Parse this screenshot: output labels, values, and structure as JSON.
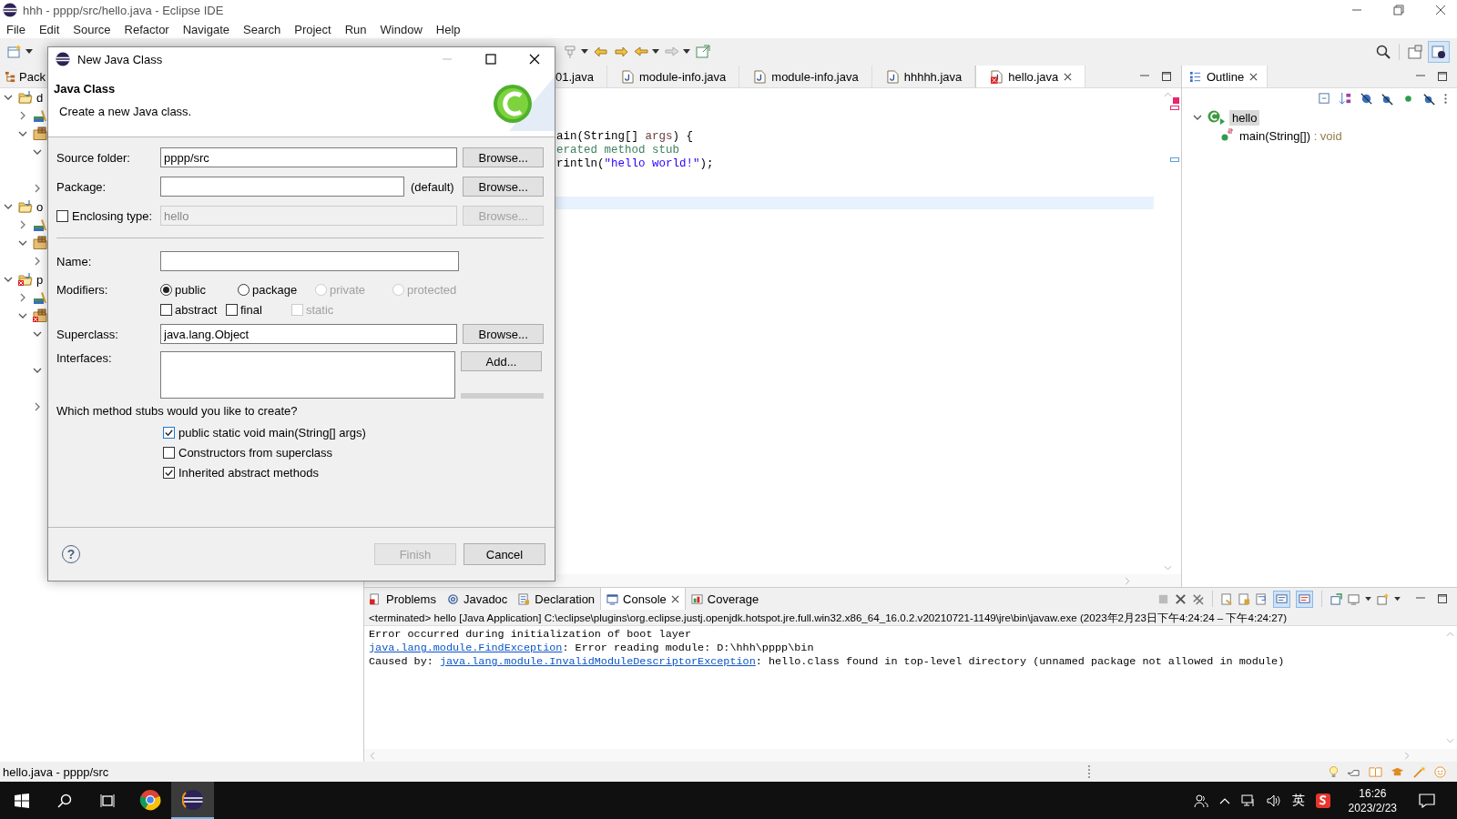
{
  "window": {
    "title": "hhh - pppp/src/hello.java - Eclipse IDE"
  },
  "menu": [
    "File",
    "Edit",
    "Source",
    "Refactor",
    "Navigate",
    "Search",
    "Project",
    "Run",
    "Window",
    "Help"
  ],
  "package_explorer": {
    "tab": "Pack",
    "tree": [
      {
        "label": "d",
        "kind": "project",
        "error": false,
        "expanded": true,
        "children": [
          {
            "kind": "library",
            "error": false,
            "expanded": false
          },
          {
            "kind": "package",
            "error": false,
            "expanded": true,
            "children": [
              {
                "expanded": true
              },
              {
                "expanded": false
              }
            ]
          }
        ]
      },
      {
        "label": "o",
        "kind": "project",
        "error": false,
        "expanded": true,
        "children": [
          {
            "kind": "library",
            "error": false,
            "expanded": false
          },
          {
            "kind": "package",
            "error": false,
            "expanded": true,
            "children": [
              {
                "expanded": false
              }
            ]
          }
        ]
      },
      {
        "label": "p",
        "kind": "project",
        "error": true,
        "expanded": true,
        "children": [
          {
            "kind": "library",
            "error": false,
            "expanded": false
          },
          {
            "kind": "package",
            "error": true,
            "expanded": true,
            "children": [
              {
                "expanded": true
              },
              {
                "expanded": true
              },
              {
                "expanded": false
              }
            ]
          }
        ]
      }
    ]
  },
  "editor": {
    "tabs": [
      {
        "label": "01.java",
        "selected": false
      },
      {
        "label": "module-info.java",
        "selected": false,
        "error": false
      },
      {
        "label": "module-info.java",
        "selected": false,
        "error": false
      },
      {
        "label": "hhhhh.java",
        "selected": false,
        "error": false
      },
      {
        "label": "hello.java",
        "selected": true,
        "error": true
      }
    ],
    "lines": [
      [
        {
          "kind": "code",
          "text": "ain(String[] "
        },
        {
          "kind": "param",
          "text": "args"
        },
        {
          "kind": "code",
          "text": ") {"
        }
      ],
      [
        {
          "kind": "comment",
          "text": "erated method stub"
        }
      ],
      [
        {
          "kind": "code",
          "text": "rintln("
        },
        {
          "kind": "string",
          "text": "\"hello world!\""
        },
        {
          "kind": "code",
          "text": ");"
        }
      ]
    ]
  },
  "outline": {
    "tab": "Outline",
    "tree": [
      {
        "label": "hello",
        "selected": true,
        "expanded": true,
        "children": [
          {
            "label": "main(String[])",
            "type": " : void",
            "selected": false
          }
        ]
      }
    ]
  },
  "console": {
    "tabs": [
      {
        "label": "Problems",
        "kind": "problems",
        "selected": false
      },
      {
        "label": "Javadoc",
        "kind": "javadoc",
        "selected": false
      },
      {
        "label": "Declaration",
        "kind": "declaration",
        "selected": false
      },
      {
        "label": "Console",
        "kind": "console",
        "selected": true
      },
      {
        "label": "Coverage",
        "kind": "coverage",
        "selected": false
      }
    ],
    "header": "<terminated> hello [Java Application] C:\\eclipse\\plugins\\org.eclipse.justj.openjdk.hotspot.jre.full.win32.x86_64_16.0.2.v20210721-1149\\jre\\bin\\javaw.exe  (2023年2月23日下午4:24:24 – 下午4:24:27)",
    "lines": [
      [
        {
          "kind": "text",
          "text": "Error occurred during initialization of boot layer"
        }
      ],
      [
        {
          "kind": "link",
          "text": "java.lang.module.FindException"
        },
        {
          "kind": "text",
          "text": ": Error reading module: D:\\hhh\\pppp\\bin"
        }
      ],
      [
        {
          "kind": "text",
          "text": "Caused by: "
        },
        {
          "kind": "link",
          "text": "java.lang.module.InvalidModuleDescriptorException"
        },
        {
          "kind": "text",
          "text": ": hello.class found in top-level directory (unnamed package not allowed in module)"
        }
      ]
    ]
  },
  "status_bar": {
    "text": "hello.java - pppp/src"
  },
  "taskbar": {
    "apps": [
      {
        "kind": "chrome",
        "selected": false
      },
      {
        "kind": "eclipse",
        "selected": true
      }
    ],
    "ime": "英",
    "time": "16:26",
    "date": "2023/2/23"
  },
  "dialog": {
    "title": "New Java Class",
    "heading": "Java Class",
    "description": "Create a new Java class.",
    "source_folder": {
      "label": "Source folder:",
      "value": "pppp/src",
      "button": "Browse..."
    },
    "package": {
      "label": "Package:",
      "note": "(default)",
      "button": "Browse..."
    },
    "enclosing_type": {
      "label": "Enclosing type:",
      "checked": false,
      "disabled": true,
      "value": "hello",
      "button": "Browse..."
    },
    "name": {
      "label": "Name:"
    },
    "modifiers": {
      "label": "Modifiers:",
      "access": [
        {
          "label": "public",
          "selected": true,
          "disabled": false
        },
        {
          "label": "package",
          "selected": false,
          "disabled": false
        },
        {
          "label": "private",
          "selected": false,
          "disabled": true
        },
        {
          "label": "protected",
          "selected": false,
          "disabled": true
        }
      ],
      "flags": [
        {
          "label": "abstract",
          "checked": false,
          "disabled": false
        },
        {
          "label": "final",
          "checked": false,
          "disabled": false
        },
        {
          "label": "static",
          "checked": false,
          "disabled": true
        }
      ]
    },
    "superclass": {
      "label": "Superclass:",
      "value": "java.lang.Object",
      "button": "Browse..."
    },
    "interfaces": {
      "label": "Interfaces:",
      "button": "Add..."
    },
    "stubs": {
      "question": "Which method stubs would you like to create?",
      "options": [
        {
          "label": "public static void main(String[] args)",
          "checked": true
        },
        {
          "label": "Constructors from superclass",
          "checked": false
        },
        {
          "label": "Inherited abstract methods",
          "checked": true
        }
      ]
    },
    "help": "?",
    "buttons": [
      {
        "label": "Finish",
        "disabled": true
      },
      {
        "label": "Cancel",
        "disabled": false
      }
    ]
  }
}
